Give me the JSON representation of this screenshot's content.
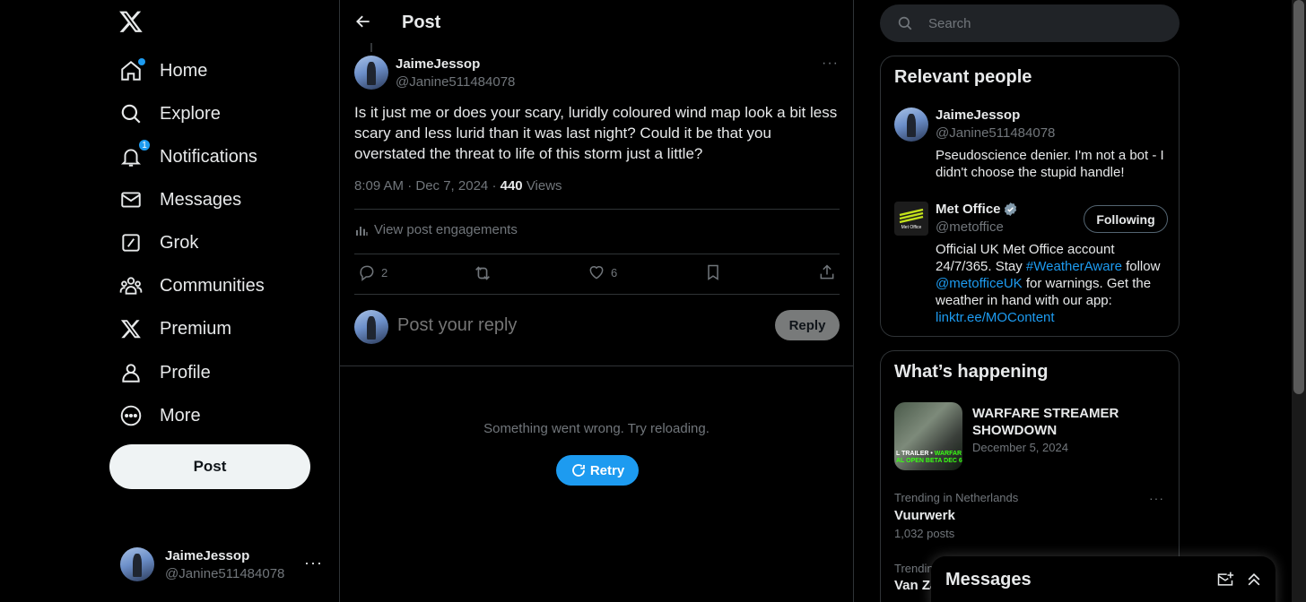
{
  "nav": {
    "items": [
      {
        "label": "Home",
        "icon": "home-icon"
      },
      {
        "label": "Explore",
        "icon": "search-icon"
      },
      {
        "label": "Notifications",
        "icon": "bell-icon",
        "badge": "1"
      },
      {
        "label": "Messages",
        "icon": "mail-icon"
      },
      {
        "label": "Grok",
        "icon": "grok-icon"
      },
      {
        "label": "Communities",
        "icon": "communities-icon"
      },
      {
        "label": "Premium",
        "icon": "x-logo-icon"
      },
      {
        "label": "Profile",
        "icon": "person-icon"
      },
      {
        "label": "More",
        "icon": "more-circle-icon"
      }
    ],
    "post_button": "Post"
  },
  "account": {
    "name": "JaimeJessop",
    "handle": "@Janine511484078"
  },
  "header": {
    "title": "Post"
  },
  "post": {
    "author_name": "JaimeJessop",
    "author_handle": "@Janine511484078",
    "text": "Is it just me or does your scary, luridly coloured wind map look a bit less scary and less lurid than it was last night? Could it be that you overstated the threat to life of this storm just a little?",
    "time": "8:09 AM · Dec 7, 2024",
    "separator": "·",
    "views_count": "440",
    "views_label": "Views",
    "engagements": "View post engagements",
    "replies": "2",
    "likes": "6"
  },
  "reply": {
    "placeholder": "Post your reply",
    "button": "Reply"
  },
  "error": {
    "message": "Something went wrong. Try reloading.",
    "retry": "Retry"
  },
  "search": {
    "placeholder": "Search"
  },
  "relevant": {
    "title": "Relevant people",
    "people": [
      {
        "name": "JaimeJessop",
        "handle": "@Janine511484078",
        "bio": "Pseudoscience denier. I'm not a bot - I didn't choose the stupid handle!"
      },
      {
        "name": "Met Office",
        "handle": "@metoffice",
        "follow": "Following",
        "bio_1": "Official UK Met Office account 24/7/365. Stay ",
        "bio_link1": "#WeatherAware",
        "bio_2": " follow ",
        "bio_link2": "@metofficeUK",
        "bio_3": " for warnings. Get the weather in hand with our app: ",
        "bio_link3": "linktr.ee/MOContent",
        "logo_text": "Met Office"
      }
    ]
  },
  "happening": {
    "title": "What’s happening",
    "featured": {
      "title": "WARFARE STREAMER SHOWDOWN",
      "date": "December 5, 2024",
      "img_line1": "L TRAILER • ",
      "img_line1_hl": "WARFAR",
      "img_line2": "AL OPEN BETA DEC 6"
    },
    "trends": [
      {
        "context": "Trending in Netherlands",
        "name": "Vuurwerk",
        "count": "1,032 posts"
      },
      {
        "context": "Trendin",
        "name": "Van Za"
      }
    ]
  },
  "messages_drawer": {
    "title": "Messages"
  },
  "colors": {
    "accent": "#1d9bf0",
    "background": "#000000",
    "text": "#e7e9ea",
    "muted": "#71767b",
    "border": "#2f3336"
  }
}
